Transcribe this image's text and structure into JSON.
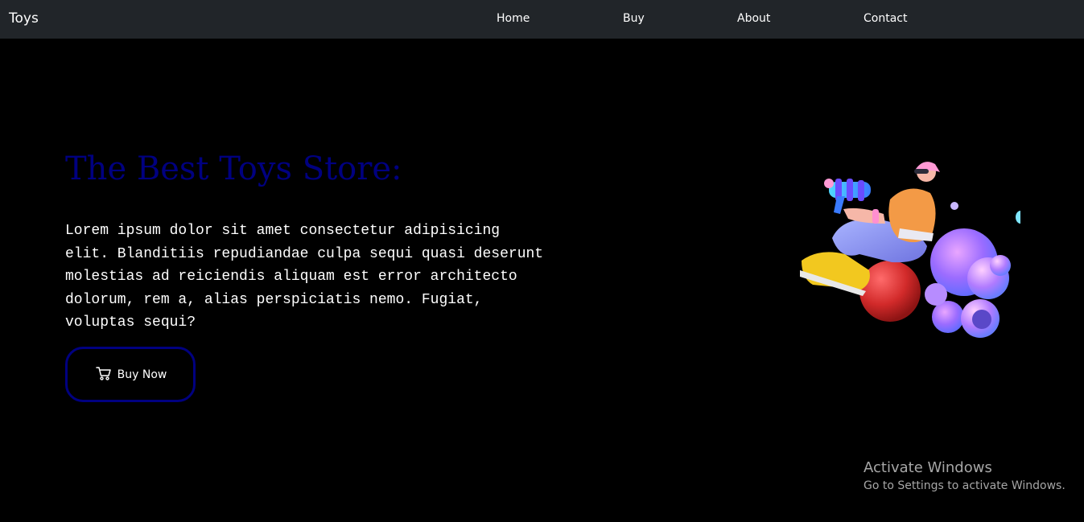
{
  "navbar": {
    "brand": "Toys",
    "links": [
      {
        "label": "Home"
      },
      {
        "label": "Buy"
      },
      {
        "label": "About"
      },
      {
        "label": "Contact"
      }
    ]
  },
  "hero": {
    "title": "The Best Toys Store:",
    "description": "Lorem ipsum dolor sit amet consectetur adipisicing elit. Blanditiis repudiandae culpa sequi quasi deserunt molestias ad reiciendis aliquam est error architecto dolorum, rem a, alias perspiciatis nemo. Fugiat, voluptas sequi?",
    "button_label": "Buy Now",
    "button_icon": "cart-icon",
    "illustration": "toy-character-illustration"
  },
  "watermark": {
    "title": "Activate Windows",
    "subtitle": "Go to Settings to activate Windows."
  },
  "colors": {
    "navbar_bg": "#212529",
    "page_bg": "#000000",
    "accent": "#000080",
    "text": "#ffffff"
  }
}
